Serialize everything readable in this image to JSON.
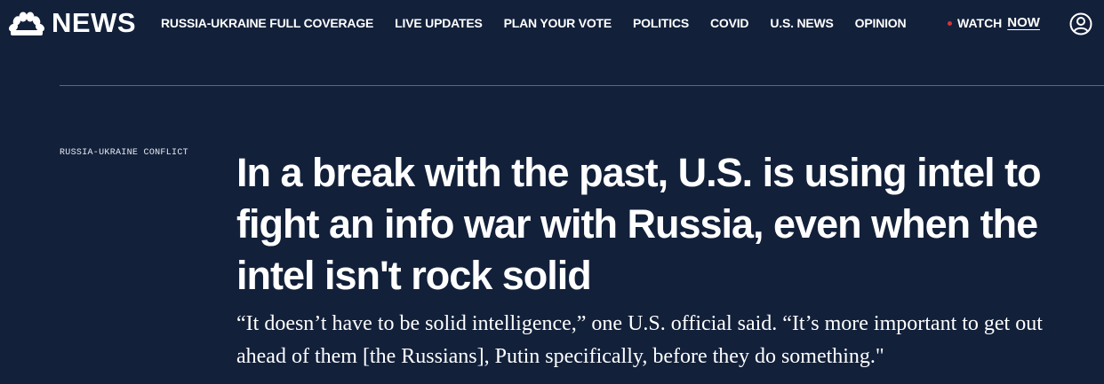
{
  "nav": {
    "logo_text": "NEWS",
    "links": [
      "RUSSIA-UKRAINE FULL COVERAGE",
      "LIVE UPDATES",
      "PLAN YOUR VOTE",
      "POLITICS",
      "COVID",
      "U.S. NEWS",
      "OPINION"
    ],
    "watch_label": "WATCH",
    "watch_now": "NOW"
  },
  "article": {
    "section": "RUSSIA-UKRAINE CONFLICT",
    "headline": "In a break with the past, U.S. is using intel to fight an info war with Russia, even when the intel isn't rock solid",
    "dek": "“It doesn’t have to be solid intelligence,” one U.S. official said. “It’s more important to get out ahead of them [the Russians], Putin specifically, before they do something.\""
  },
  "colors": {
    "background": "#12203a",
    "text": "#ffffff",
    "live_dot": "#d8323c",
    "divider": "#5a6a85"
  },
  "icons": {
    "logo": "nbc-peacock-icon",
    "account": "user-account-icon"
  }
}
